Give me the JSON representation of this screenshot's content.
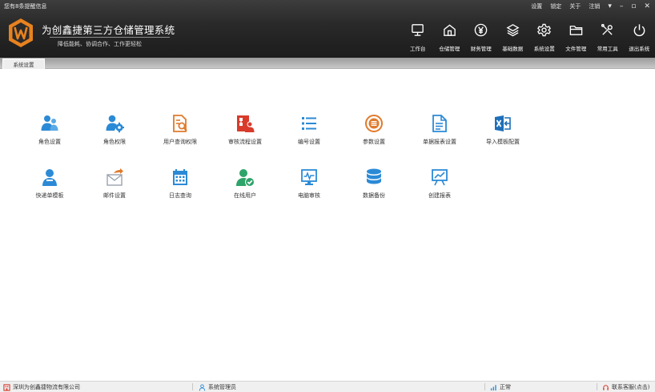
{
  "header": {
    "notice": "您有8条提醒信息",
    "system_links": [
      "设置",
      "锁定",
      "关于",
      "注销"
    ],
    "brand_title": "为创鑫捷第三方仓储管理系统",
    "brand_slogan": "降低能耗、协调合作、工作更轻松",
    "nav": [
      {
        "label": "工作台",
        "icon": "monitor-icon"
      },
      {
        "label": "仓储管理",
        "icon": "home-icon"
      },
      {
        "label": "财务管理",
        "icon": "yen-icon"
      },
      {
        "label": "基础数据",
        "icon": "layers-icon"
      },
      {
        "label": "系统设置",
        "icon": "gear-icon"
      },
      {
        "label": "文件管理",
        "icon": "folder-icon"
      },
      {
        "label": "常用工具",
        "icon": "tools-icon"
      },
      {
        "label": "退出系统",
        "icon": "power-icon"
      }
    ]
  },
  "tabs": {
    "active": "系统设置"
  },
  "modules": {
    "row1": [
      {
        "label": "角色设置",
        "icon": "users-icon"
      },
      {
        "label": "角色权限",
        "icon": "user-gear-icon"
      },
      {
        "label": "用户查询权限",
        "icon": "document-search-icon"
      },
      {
        "label": "审核流程设置",
        "icon": "workflow-icon"
      },
      {
        "label": "编号设置",
        "icon": "list-icon"
      },
      {
        "label": "参数设置",
        "icon": "parameter-icon"
      },
      {
        "label": "单据报表设置",
        "icon": "report-document-icon"
      },
      {
        "label": "导入模板配置",
        "icon": "excel-import-icon"
      }
    ],
    "row2": [
      {
        "label": "快递单模板",
        "icon": "courier-icon"
      },
      {
        "label": "邮件设置",
        "icon": "mail-icon"
      },
      {
        "label": "日志查询",
        "icon": "calendar-icon"
      },
      {
        "label": "在线用户",
        "icon": "online-user-icon"
      },
      {
        "label": "电脑审核",
        "icon": "computer-audit-icon"
      },
      {
        "label": "数据备份",
        "icon": "database-icon"
      },
      {
        "label": "创建报表",
        "icon": "chart-board-icon"
      }
    ]
  },
  "status": {
    "company": "深圳为创鑫捷物流有限公司",
    "user": "系统管理员",
    "connection": "正常",
    "support": "联系客服(点击)"
  },
  "colors": {
    "icon_blue": "#2b8ad6",
    "icon_orange": "#e07a2c",
    "icon_red": "#d83b2c",
    "icon_green": "#2ea36a",
    "logo_orange": "#e8821f"
  }
}
